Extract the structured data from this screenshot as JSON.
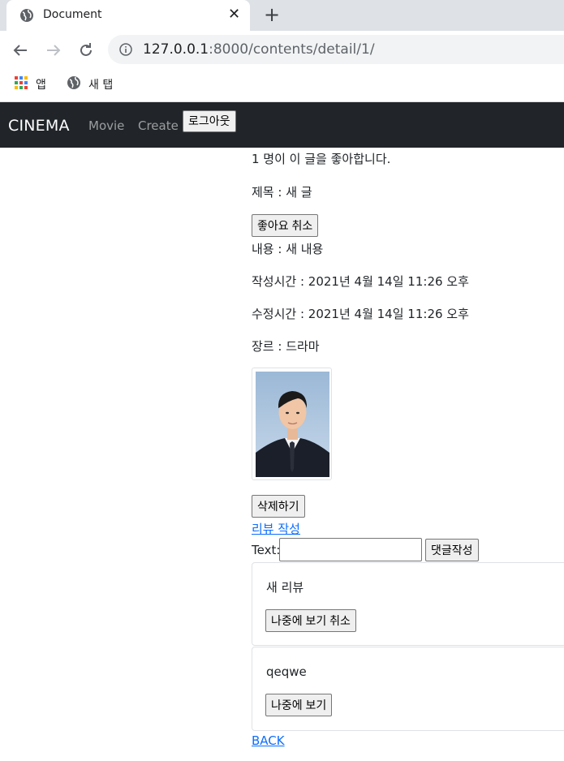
{
  "browser": {
    "tab_title": "Document",
    "url_host": "127.0.0.1",
    "url_path": ":8000/contents/detail/1/",
    "bookmarks": [
      {
        "label": "앱",
        "icon": "apps-grid-icon"
      },
      {
        "label": "새 탭",
        "icon": "globe-icon"
      }
    ]
  },
  "navbar": {
    "brand": "CINEMA",
    "links": [
      "Movie",
      "Create"
    ],
    "logout_label": "로그아웃"
  },
  "detail": {
    "likes_text": "1 명이 이 글을 좋아합니다.",
    "title_text": "제목 : 새 글",
    "unlike_label": "좋아요 취소",
    "content_text": "내용 : 새 내용",
    "created_text": "작성시간 : 2021년 4월 14일 11:26 오후",
    "updated_text": "수정시간 : 2021년 4월 14일 11:26 오후",
    "genre_text": "장르 : 드라마",
    "delete_label": "삭제하기",
    "review_link": "리뷰 작성",
    "comment_label": "Text:",
    "comment_value": "",
    "comment_submit": "댓글작성",
    "back_link": "BACK"
  },
  "reviews": [
    {
      "text": "새 리뷰",
      "button": "나중에 보기 취소"
    },
    {
      "text": "qeqwe",
      "button": "나중에 보기"
    }
  ]
}
